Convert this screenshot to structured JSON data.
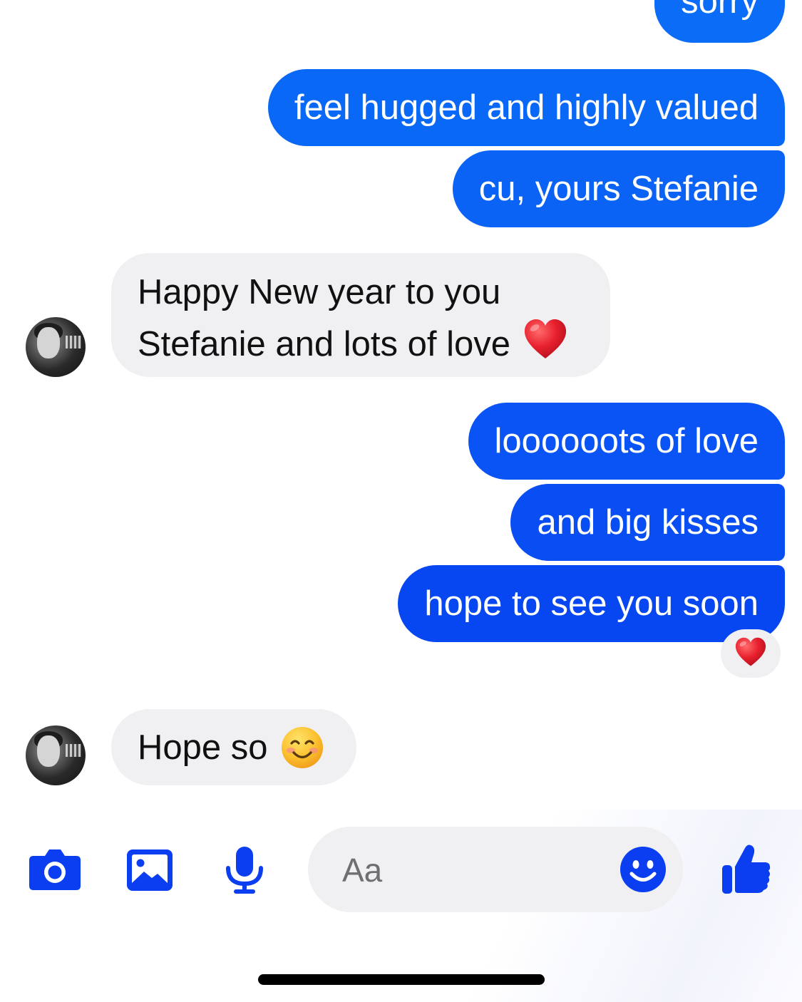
{
  "colors": {
    "accent_blue": "#0a57f5",
    "incoming_bg": "#f0f0f3",
    "heart_red": "#e8202e",
    "emoji_yellow": "#f9b92a"
  },
  "messages": [
    {
      "direction": "outgoing",
      "text": "sorry"
    },
    {
      "direction": "outgoing",
      "text": "feel hugged and highly valued"
    },
    {
      "direction": "outgoing",
      "text": "cu, yours Stefanie"
    },
    {
      "direction": "incoming",
      "line1": "Happy New year to you",
      "line2": "Stefanie and lots of love",
      "emoji": "red-heart-emoji"
    },
    {
      "direction": "outgoing",
      "text": "loooooots of love"
    },
    {
      "direction": "outgoing",
      "text": "and big kisses"
    },
    {
      "direction": "outgoing",
      "text": "hope to see you soon",
      "reaction": "red-heart-emoji"
    },
    {
      "direction": "incoming",
      "text": "Hope so",
      "emoji": "smiling-face-emoji"
    }
  ],
  "composer": {
    "placeholder": "Aa",
    "icons": [
      "camera-icon",
      "photo-gallery-icon",
      "microphone-icon",
      "emoji-icon",
      "thumbs-up-icon"
    ]
  }
}
